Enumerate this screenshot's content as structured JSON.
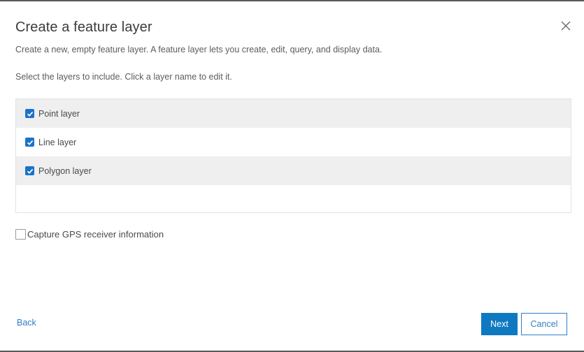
{
  "dialog": {
    "title": "Create a feature layer",
    "description": "Create a new, empty feature layer. A feature layer lets you create, edit, query, and display data.",
    "instructions": "Select the layers to include. Click a layer name to edit it.",
    "close_icon": "close-icon"
  },
  "layers": [
    {
      "label": "Point layer",
      "checked": true
    },
    {
      "label": "Line layer",
      "checked": true
    },
    {
      "label": "Polygon layer",
      "checked": true
    }
  ],
  "gps": {
    "label": "Capture GPS receiver information",
    "checked": false
  },
  "footer": {
    "back_label": "Back",
    "next_label": "Next",
    "cancel_label": "Cancel"
  },
  "colors": {
    "accent": "#0e79c1",
    "link": "#2e7fc7",
    "row_shade": "#efefef"
  }
}
